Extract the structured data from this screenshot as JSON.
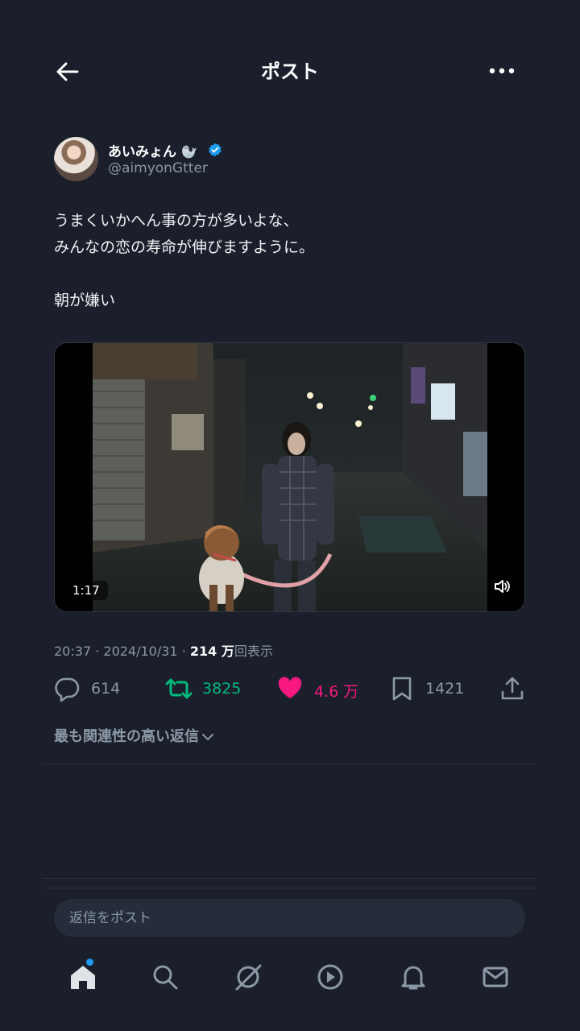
{
  "header": {
    "title": "ポスト",
    "back_icon": "arrow-left-icon",
    "more_icon": "more-horizontal-icon"
  },
  "post": {
    "author_name": "あいみょん",
    "author_emoji": "🦭",
    "verified_icon": "verified-badge-icon",
    "handle": "@aimyonGtter",
    "text": "うまくいかへん事の方が多いよな、\nみんなの恋の寿命が伸びますように。\n\n朝が嫌い",
    "video": {
      "duration": "1:17",
      "volume_icon": "volume-icon"
    },
    "meta": {
      "time": "20:37",
      "separator": "·",
      "date": "2024/10/31",
      "views_count": "214 万",
      "views_label": "回表示"
    }
  },
  "actions": {
    "reply_count": "614",
    "retweet_count": "3825",
    "like_count": "4.6 万",
    "bookmark_count": "1421",
    "colors": {
      "retweet": "#00ba7c",
      "like": "#f91880",
      "muted": "#8b98a5"
    }
  },
  "replies": {
    "sort_label": "最も関連性の高い返信"
  },
  "reply_input": {
    "placeholder": "返信をポスト"
  },
  "tabbar": {
    "items": [
      "home-icon",
      "search-icon",
      "grok-icon",
      "video-icon",
      "notifications-icon",
      "messages-icon"
    ],
    "active": "home-icon",
    "accent": "#1d9bf0"
  }
}
